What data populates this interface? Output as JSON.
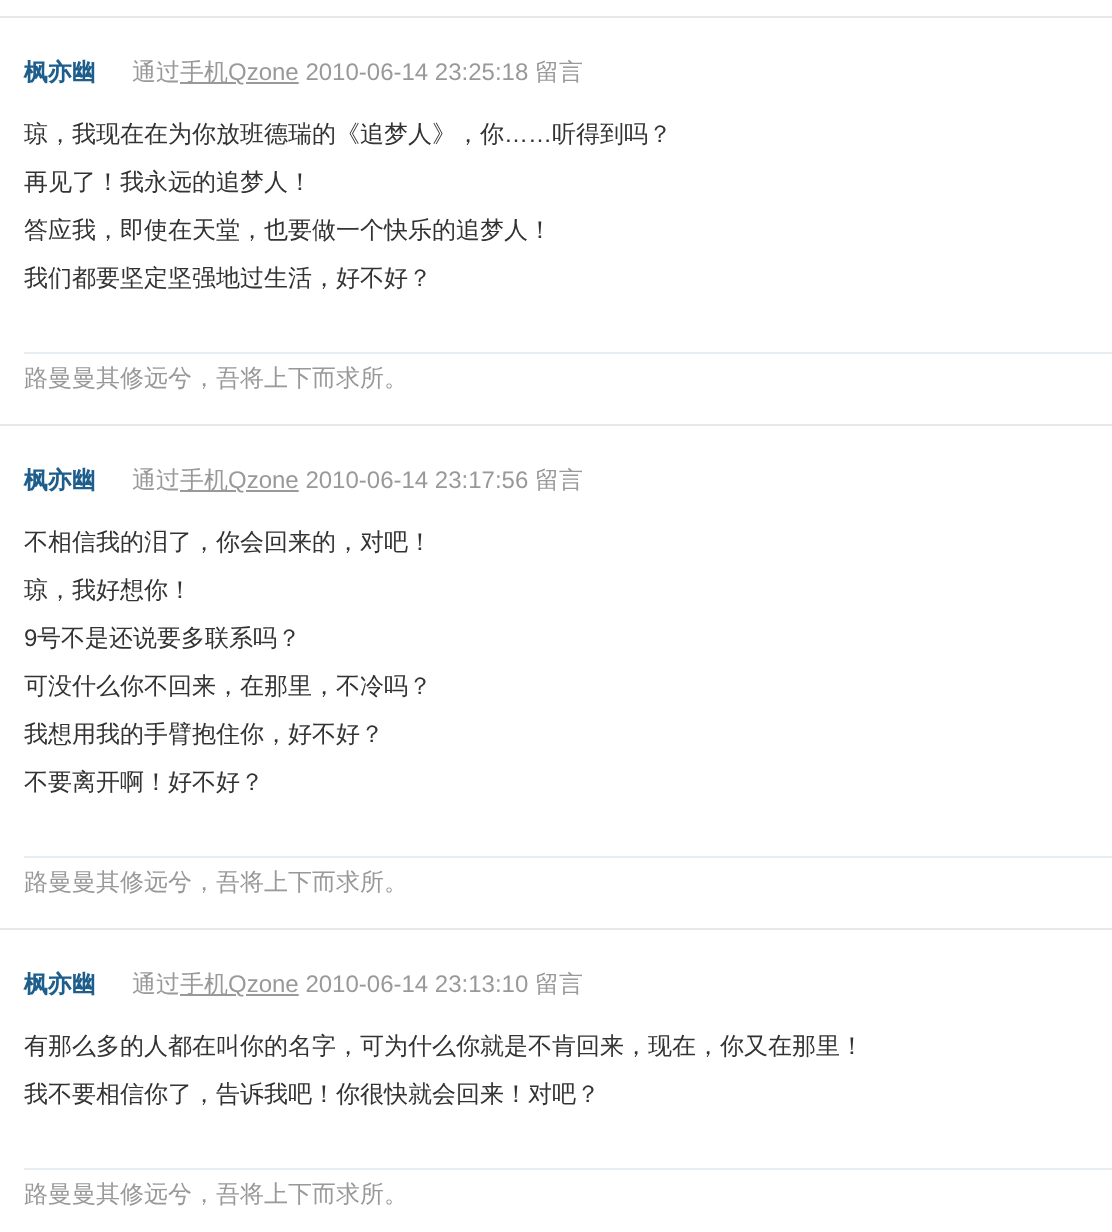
{
  "entries": [
    {
      "author": "枫亦幽",
      "via": "通过",
      "source_link": "手机Qzone",
      "time": "2010-06-14 23:25:18",
      "action": "留言",
      "lines": [
        "琼，我现在在为你放班德瑞的《追梦人》，你……听得到吗？",
        "再见了！我永远的追梦人！",
        "答应我，即使在天堂，也要做一个快乐的追梦人！",
        "我们都要坚定坚强地过生活，好不好？"
      ],
      "signature": "路曼曼其修远兮，吾将上下而求所。"
    },
    {
      "author": "枫亦幽",
      "via": "通过",
      "source_link": "手机Qzone",
      "time": "2010-06-14 23:17:56",
      "action": "留言",
      "lines": [
        "不相信我的泪了，你会回来的，对吧！",
        "琼，我好想你！",
        "9号不是还说要多联系吗？",
        "可没什么你不回来，在那里，不冷吗？",
        "我想用我的手臂抱住你，好不好？",
        "不要离开啊！好不好？"
      ],
      "signature": "路曼曼其修远兮，吾将上下而求所。"
    },
    {
      "author": "枫亦幽",
      "via": "通过",
      "source_link": "手机Qzone",
      "time": "2010-06-14 23:13:10",
      "action": "留言",
      "lines": [
        "有那么多的人都在叫你的名字，可为什么你就是不肯回来，现在，你又在那里！",
        "我不要相信你了，告诉我吧！你很快就会回来！对吧？"
      ],
      "signature": "路曼曼其修远兮，吾将上下而求所。"
    }
  ]
}
